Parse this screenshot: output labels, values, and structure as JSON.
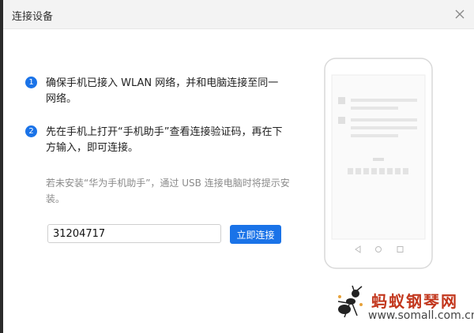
{
  "dialog": {
    "title": "连接设备",
    "close_icon": "close-icon"
  },
  "steps": [
    {
      "number": "1",
      "text": "确保手机已接入 WLAN 网络，并和电脑连接至同一网络。"
    },
    {
      "number": "2",
      "text": "先在手机上打开“手机助手”查看连接验证码，再在下方输入，即可连接。"
    }
  ],
  "note": "若未安装“华为手机助手”，通过 USB 连接电脑时将提示安装。",
  "code_input": {
    "value": "31204717"
  },
  "connect_button": {
    "label": "立即连接"
  },
  "watermark": {
    "brand": "蚂蚁钢琴网",
    "url": "www.somall.com.cn"
  },
  "colors": {
    "accent": "#1a73e8",
    "watermark_red": "#c2361c"
  }
}
